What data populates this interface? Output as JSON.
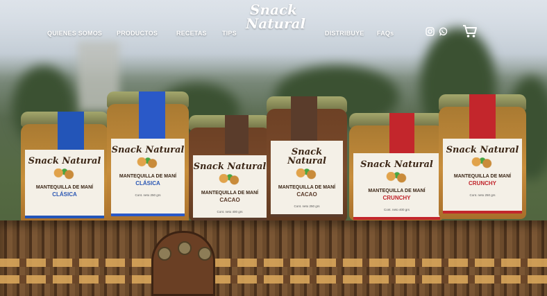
{
  "nav": {
    "logo_line1": "Snack",
    "logo_line2": "Natural",
    "items": [
      "QUIENES SOMOS",
      "PRODUCTOS",
      "RECETAS",
      "TIPS",
      "DISTRIBUYE",
      "FAQs"
    ]
  },
  "icons": {
    "instagram": "instagram-icon",
    "whatsapp": "whatsapp-icon",
    "cart": "cart-icon"
  },
  "products": [
    {
      "brand": "Snack Natural",
      "product": "MANTEQUILLA DE MANÍ",
      "flavor": "CLÁSICA",
      "net": "Cont. neto 250 grs",
      "tape_color": "#2355b8",
      "accent": "#2c58b4"
    },
    {
      "brand": "Snack Natural",
      "product": "MANTEQUILLA DE MANÍ",
      "flavor": "CLÁSICA",
      "net": "Cont. neto 250 grs",
      "tape_color": "#2a59c8",
      "accent": "#2c58b4"
    },
    {
      "brand": "Snack Natural",
      "product": "MANTEQUILLA DE MANÍ",
      "flavor": "CACAO",
      "net": "Cont. neto 400 grs",
      "tape_color": "#5a3c2b",
      "accent": "#5a3a29"
    },
    {
      "brand": "Snack Natural",
      "product": "MANTEQUILLA DE MANÍ",
      "flavor": "CACAO",
      "net": "Cont. neto 250 grs",
      "tape_color": "#5a3c2b",
      "accent": "#5a3a29"
    },
    {
      "brand": "Snack Natural",
      "product": "MANTEQUILLA DE MANÍ",
      "flavor": "CRUNCHY",
      "net": "Cont. neto 400 grs",
      "tape_color": "#c3262c",
      "accent": "#c0232a"
    },
    {
      "brand": "Snack Natural",
      "product": "MANTEQUILLA DE MANÍ",
      "flavor": "CRUNCHY",
      "net": "Cont. neto 250 grs",
      "tape_color": "#c3262c",
      "accent": "#c0232a"
    }
  ]
}
